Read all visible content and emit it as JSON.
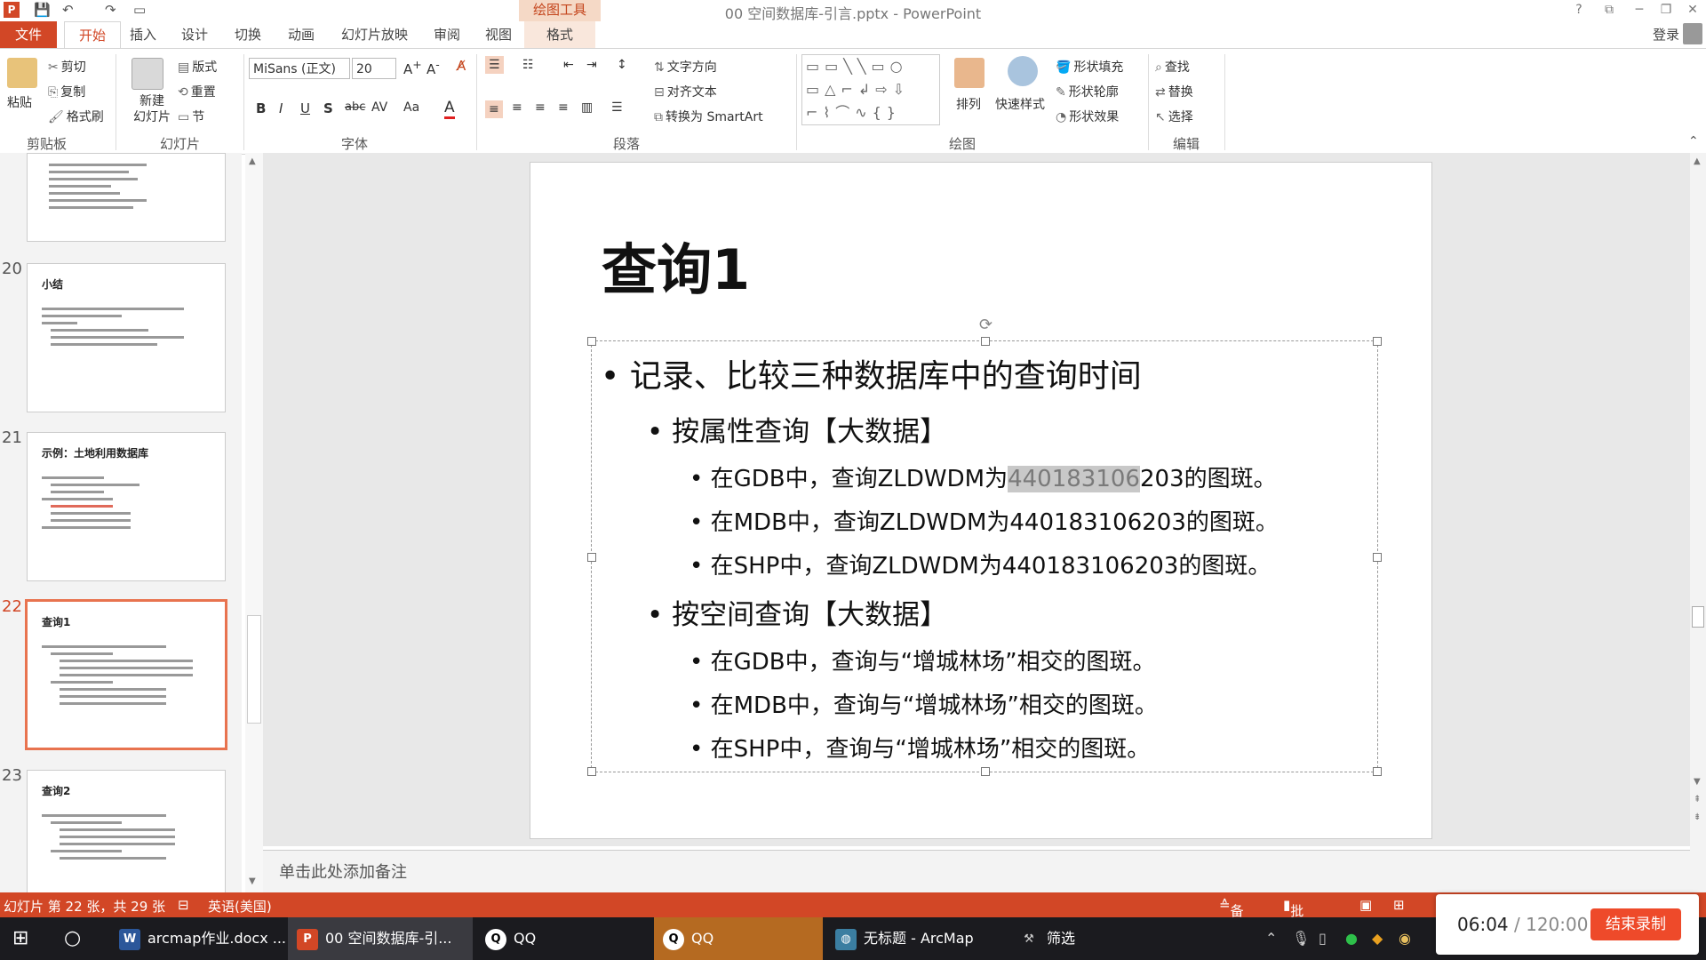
{
  "titlebar": {
    "doc_title": "00 空间数据库-引言.pptx - PowerPoint",
    "context_tab": "绘图工具",
    "help": "?",
    "minimize": "─",
    "restore": "❐",
    "close": "✕"
  },
  "tabs": {
    "file": "文件",
    "home": "开始",
    "insert": "插入",
    "design": "设计",
    "transitions": "切换",
    "animations": "动画",
    "slideshow": "幻灯片放映",
    "review": "审阅",
    "view": "视图",
    "format": "格式",
    "login": "登录"
  },
  "ribbon": {
    "paste": "粘贴",
    "cut": "剪切",
    "copy": "复制",
    "format_painter": "格式刷",
    "clipboard_label": "剪贴板",
    "new_slide": "新建\n幻灯片",
    "new_slide_1": "新建",
    "new_slide_2": "幻灯片",
    "layout": "版式",
    "reset": "重置",
    "section": "节",
    "slides_label": "幻灯片",
    "font_name": "MiSans (正文)",
    "font_size": "20",
    "font_label": "字体",
    "text_direction": "文字方向",
    "align_text": "对齐文本",
    "convert_smartart": "转换为 SmartArt",
    "paragraph_label": "段落",
    "arrange": "排列",
    "quick_styles": "快速样式",
    "shape_fill": "形状填充",
    "shape_outline": "形状轮廓",
    "shape_effects": "形状效果",
    "drawing_label": "绘图",
    "find": "查找",
    "replace": "替换",
    "select": "选择",
    "editing_label": "编辑"
  },
  "thumbnails": [
    {
      "num": "20",
      "title": "小结"
    },
    {
      "num": "21",
      "title": "示例：土地利用数据库"
    },
    {
      "num": "22",
      "title": "查询1"
    },
    {
      "num": "23",
      "title": "查询2"
    }
  ],
  "slide": {
    "title": "查询1",
    "bullet1": "记录、比较三种数据库中的查询时间",
    "sub1": "按属性查询【大数据】",
    "gdb_attr_pre": "在GDB中，查询ZLDWDM为",
    "gdb_attr_hl": "440183106",
    "gdb_attr_post": "203的图斑。",
    "mdb_attr": "在MDB中，查询ZLDWDM为440183106203的图斑。",
    "shp_attr": "在SHP中，查询ZLDWDM为440183106203的图斑。",
    "sub2": "按空间查询【大数据】",
    "gdb_spatial": "在GDB中，查询与“增城林场”相交的图斑。",
    "mdb_spatial": "在MDB中，查询与“增城林场”相交的图斑。",
    "shp_spatial": "在SHP中，查询与“增城林场”相交的图斑。"
  },
  "notes": {
    "placeholder": "单击此处添加备注"
  },
  "statusbar": {
    "slide_info": "幻灯片 第 22 张，共 29 张",
    "language": "英语(美国)",
    "notes": "备注",
    "comments": "批注"
  },
  "taskbar": {
    "word": "arcmap作业.docx ...",
    "ppt": "00 空间数据库-引...",
    "qq1": "QQ",
    "qq2": "QQ",
    "arcmap": "无标题 - ArcMap",
    "filter": "筛选"
  },
  "recording": {
    "elapsed": "06:04",
    "total": "/ 120:00",
    "stop_button": "结束录制"
  },
  "colors": {
    "accent": "#d24726",
    "selection": "#e8734f",
    "record_button": "#ee4a2a"
  }
}
